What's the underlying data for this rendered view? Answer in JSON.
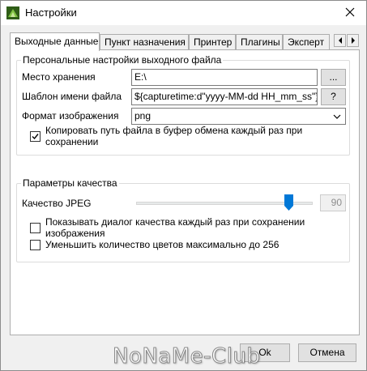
{
  "window": {
    "title": "Настройки"
  },
  "tabs": [
    {
      "label": "Выходные данные",
      "active": true
    },
    {
      "label": "Пункт назначения",
      "active": false
    },
    {
      "label": "Принтер",
      "active": false
    },
    {
      "label": "Плагины",
      "active": false
    },
    {
      "label": "Эксперт",
      "active": false
    }
  ],
  "output_group": {
    "legend": "Персональные настройки выходного файла",
    "storage_label": "Место хранения",
    "storage_value": "E:\\",
    "browse_label": "...",
    "filename_label": "Шаблон имени файла",
    "filename_value": "${capturetime:d\"yyyy-MM-dd HH_mm_ss\"}-${title}",
    "help_label": "?",
    "format_label": "Формат изображения",
    "format_value": "png",
    "copy_path_label": "Копировать путь файла в буфер обмена каждый раз при сохранении",
    "copy_path_checked": true
  },
  "quality_group": {
    "legend": "Параметры качества",
    "jpeg_label": "Качество JPEG",
    "jpeg_value": "90",
    "jpeg_level": 90,
    "show_dialog_label": "Показывать диалог качества каждый раз при сохранении изображения",
    "show_dialog_checked": false,
    "reduce_colors_label": "Уменьшить количество цветов максимально до 256",
    "reduce_colors_checked": false
  },
  "buttons": {
    "ok": "Ok",
    "cancel": "Отмена"
  },
  "watermark": "NoNaMe-Club",
  "colors": {
    "accent": "#0078d7",
    "app_icon": "#3c6e1e"
  }
}
